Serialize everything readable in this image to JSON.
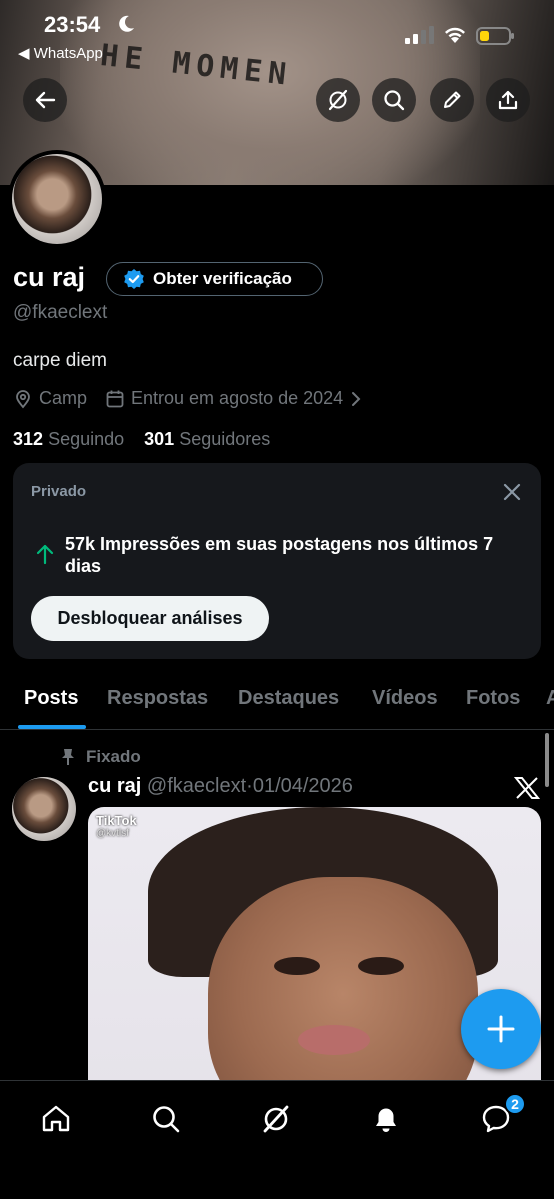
{
  "status_bar": {
    "time": "23:54",
    "back_app": "◀ WhatsApp"
  },
  "banner": {
    "tattoo_text": "HE MOMEN"
  },
  "profile": {
    "name": "cu raj",
    "verify_label": "Obter verificação",
    "handle": "@fkaeclext",
    "bio": "carpe diem",
    "location": "Camp",
    "joined": "Entrou em agosto de 2024",
    "following_count": "312",
    "following_label": "Seguindo",
    "followers_count": "301",
    "followers_label": "Seguidores"
  },
  "analytics_card": {
    "label": "Privado",
    "stat": "57k Impressões em suas postagens nos últimos 7 dias",
    "button": "Desbloquear análises"
  },
  "tabs": [
    "Posts",
    "Respostas",
    "Destaques",
    "Vídeos",
    "Fotos",
    "A"
  ],
  "post": {
    "pinned_label": "Fixado",
    "author": "cu raj",
    "handle": "@fkaeclext",
    "separator": "·",
    "date": "01/04/2026",
    "media_watermark": "TikTok",
    "media_watermark_user": "@kvtlsf"
  },
  "bottom_nav": {
    "items": [
      "home-icon",
      "search-icon",
      "grok-icon",
      "notifications-icon",
      "messages-icon"
    ],
    "messages_badge": "2"
  },
  "colors": {
    "accent": "#1d9bf0",
    "background": "#000000",
    "secondary_text": "#71767b",
    "card": "#16181c",
    "up_arrow": "#00ba7c"
  }
}
